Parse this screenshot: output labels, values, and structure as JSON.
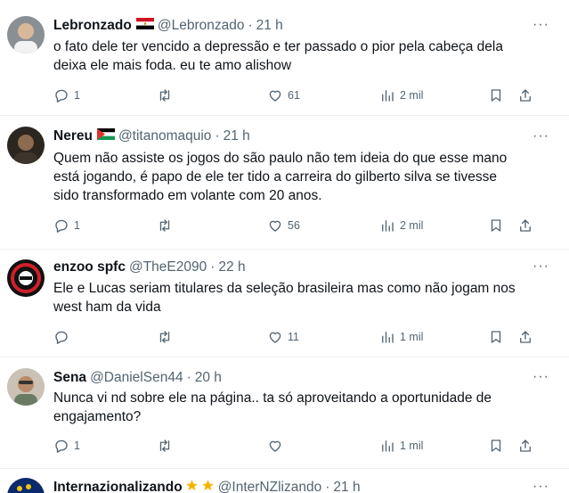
{
  "tweets": [
    {
      "name": "Lebronzado",
      "flag": "egypt-flag",
      "handle": "@Lebronzado",
      "time": "21 h",
      "text_lines": [
        "o fato dele ter vencido a depressão e ter passado o pior pela cabeça dela",
        "deixa ele mais foda. eu te amo alishow"
      ],
      "replies": "1",
      "retweets": "",
      "likes": "61",
      "views": "2 mil"
    },
    {
      "name": "Nereu",
      "flag": "palestine-flag",
      "handle": "@titanomaquio",
      "time": "21 h",
      "text_lines": [
        "Quem não assiste os jogos do são paulo não tem ideia do que esse mano",
        "está jogando, é papo de ele ter tido a carreira do gilberto silva se tivesse",
        "sido transformado em volante com 20 anos."
      ],
      "replies": "1",
      "retweets": "",
      "likes": "56",
      "views": "2 mil"
    },
    {
      "name": "enzoo spfc",
      "flag": "",
      "handle": "@TheE2090",
      "time": "22 h",
      "text_lines": [
        "Ele e Lucas seriam titulares da seleção brasileira mas como não jogam nos",
        "west ham da vida"
      ],
      "replies": "",
      "retweets": "",
      "likes": "11",
      "views": "1 mil"
    },
    {
      "name": "Sena",
      "flag": "",
      "handle": "@DanielSen44",
      "time": "20 h",
      "text_lines": [
        "Nunca vi nd sobre ele na página.. ta só aproveitando a oportunidade de",
        "engajamento?"
      ],
      "replies": "1",
      "retweets": "",
      "likes": "",
      "views": "1 mil"
    },
    {
      "name": "Internazionalizando",
      "flag": "star-icons",
      "handle": "@InterNZlizando",
      "time": "21 h"
    }
  ],
  "more_label": "···",
  "separator": "·",
  "colors": {
    "text": "#0f1419",
    "secondary": "#536471",
    "divider": "#eff3f4"
  }
}
